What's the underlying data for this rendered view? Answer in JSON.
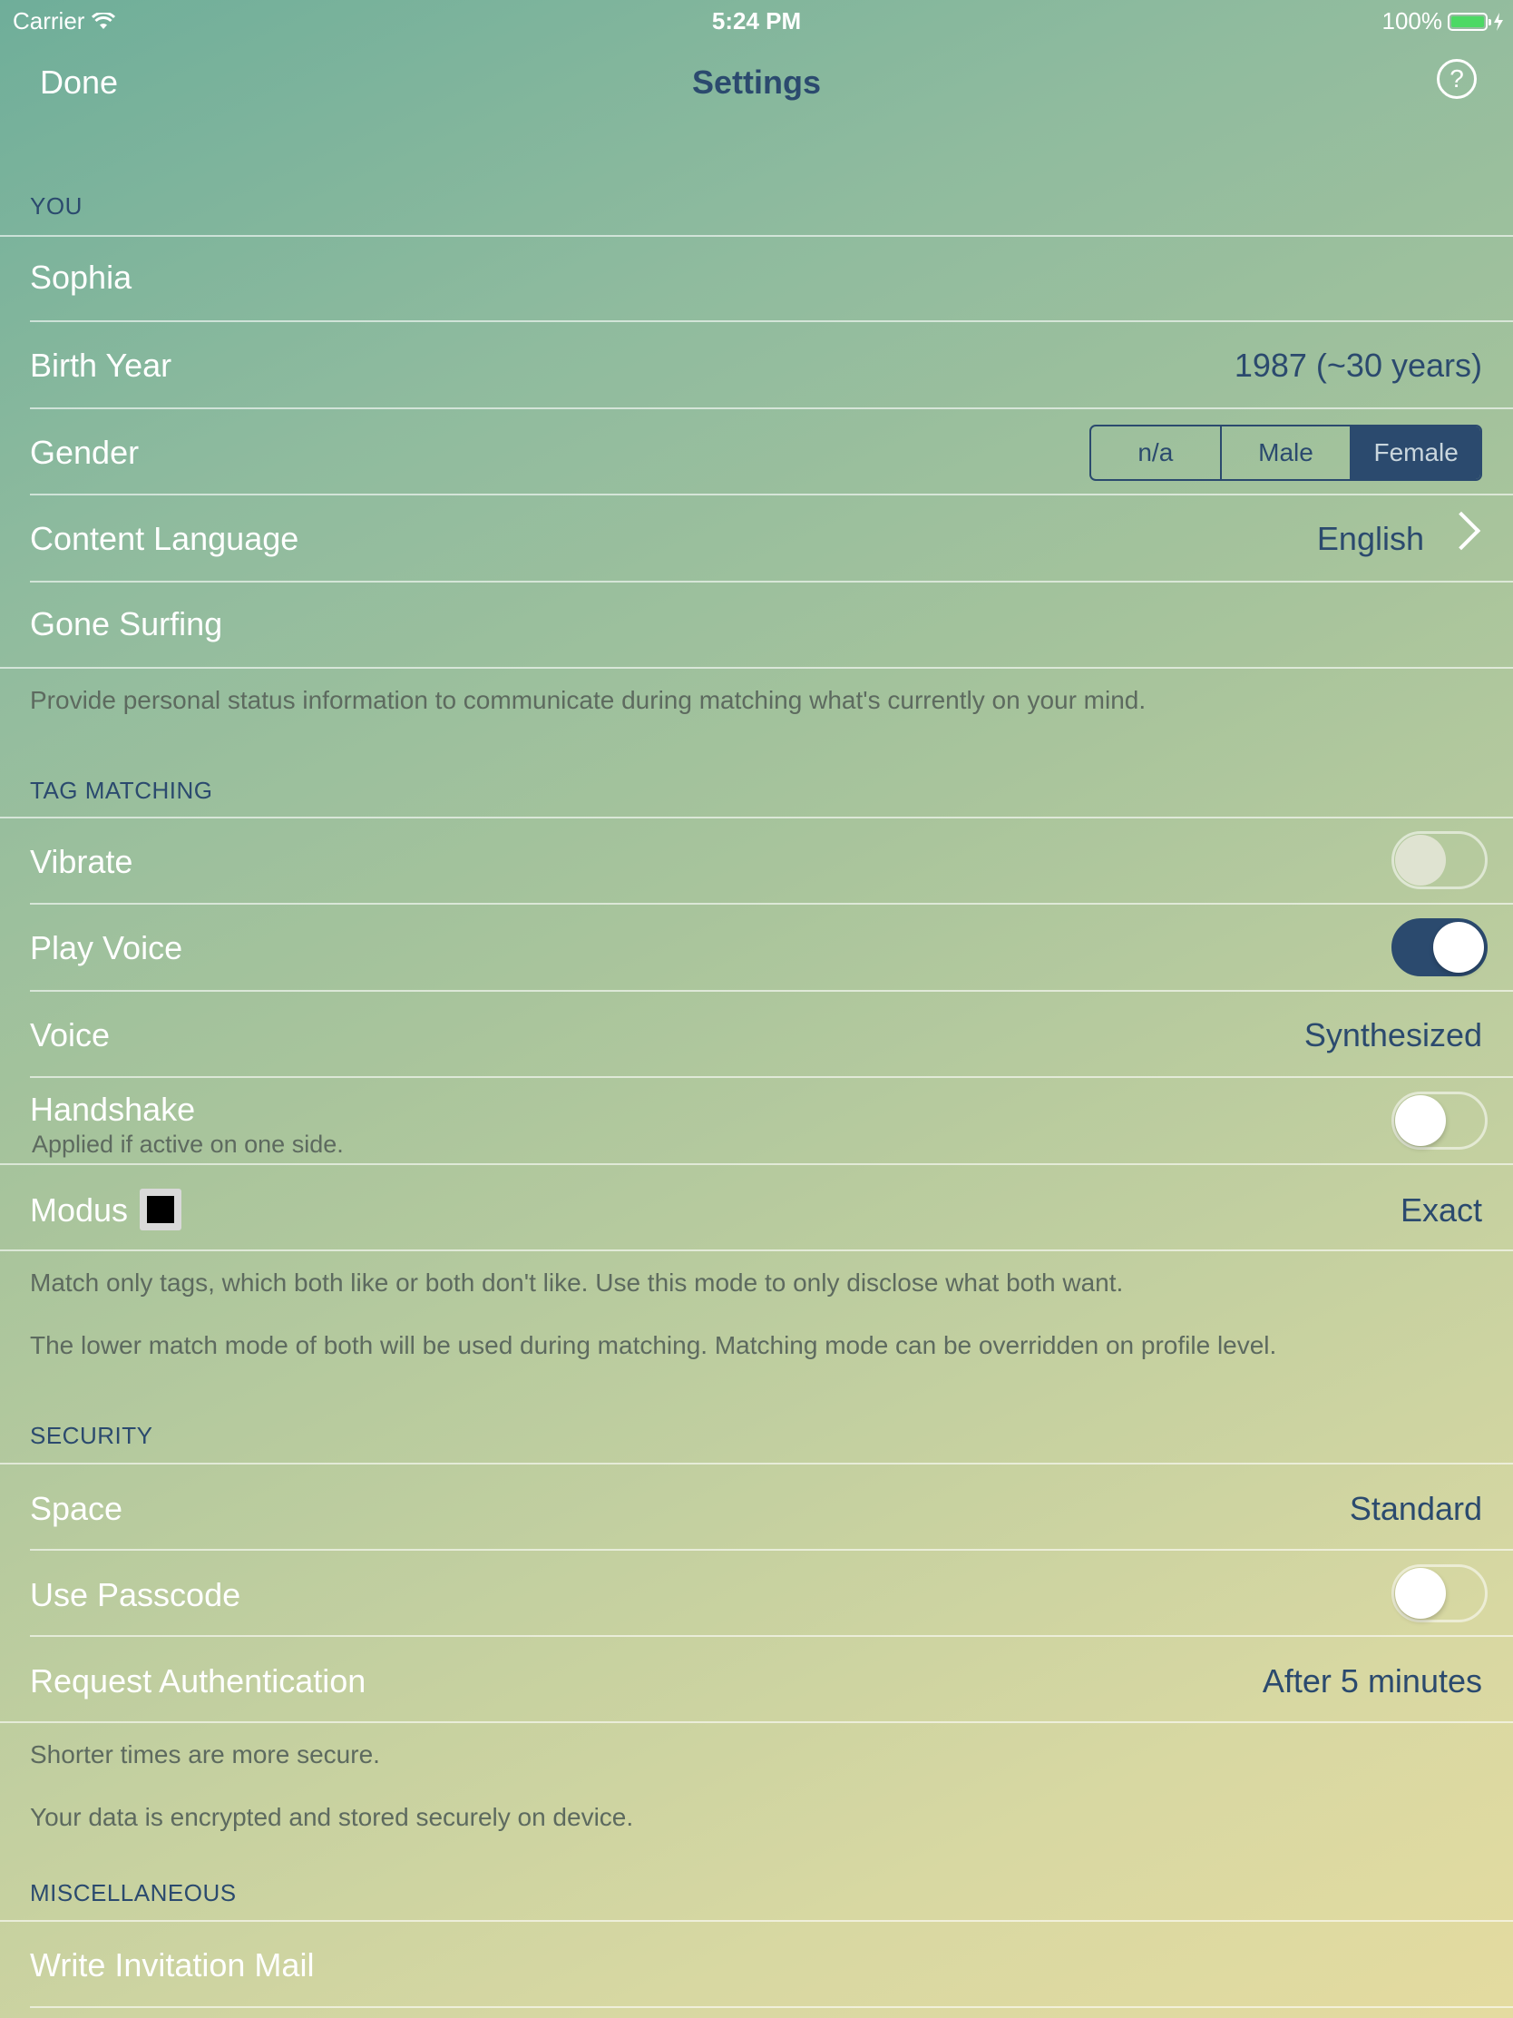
{
  "status_bar": {
    "carrier": "Carrier",
    "time": "5:24 PM",
    "battery": "100%",
    "icons": [
      "wifi-icon",
      "battery-icon",
      "charging-bolt-icon"
    ]
  },
  "nav": {
    "done": "Done",
    "title": "Settings",
    "help": "?"
  },
  "sections": {
    "you": {
      "header": "YOU",
      "name": "Sophia",
      "birth_year_label": "Birth Year",
      "birth_year_value": "1987 (~30 years)",
      "gender_label": "Gender",
      "gender_options": [
        "n/a",
        "Male",
        "Female"
      ],
      "gender_selected": "Female",
      "language_label": "Content Language",
      "language_value": "English",
      "status": "Gone Surfing",
      "footer": "Provide personal status information to communicate during matching what's currently on your mind."
    },
    "tag_matching": {
      "header": "TAG MATCHING",
      "vibrate_label": "Vibrate",
      "vibrate_on": false,
      "play_voice_label": "Play Voice",
      "play_voice_on": true,
      "voice_label": "Voice",
      "voice_value": "Synthesized",
      "handshake_label": "Handshake",
      "handshake_sub": "Applied if active on one side.",
      "handshake_on": false,
      "modus_label": "Modus",
      "modus_value": "Exact",
      "modus_color": "#000000",
      "footer1": "Match only tags, which both like or both don't like. Use this mode to only disclose what both want.",
      "footer2": "The lower match mode of both will be used during matching. Matching mode can be overridden on profile level."
    },
    "security": {
      "header": "SECURITY",
      "space_label": "Space",
      "space_value": "Standard",
      "passcode_label": "Use Passcode",
      "passcode_on": false,
      "auth_label": "Request Authentication",
      "auth_value": "After 5 minutes",
      "footer1": "Shorter times are more secure.",
      "footer2": "Your data is encrypted and stored securely on device."
    },
    "misc": {
      "header": "MISCELLANEOUS",
      "invite": "Write Invitation Mail"
    }
  },
  "colors": {
    "accent": "#2b4a6e",
    "toggle_on": "#2b4a6e",
    "battery": "#4cd964"
  }
}
